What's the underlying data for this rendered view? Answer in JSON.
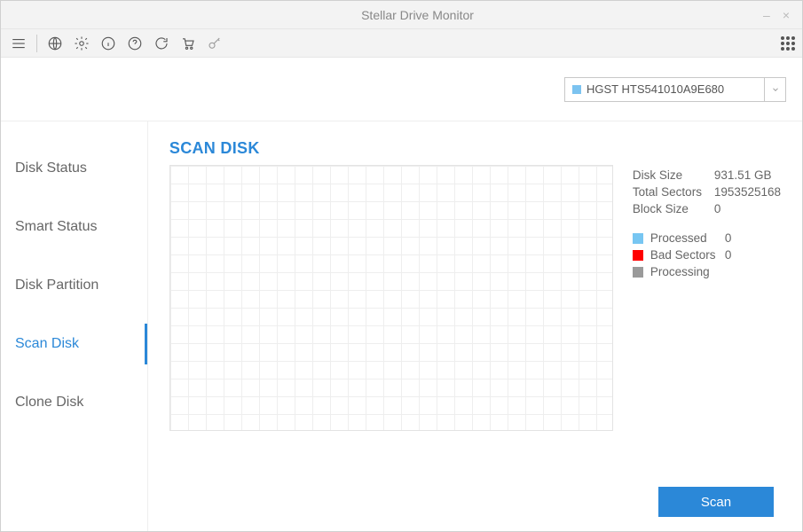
{
  "window": {
    "title": "Stellar Drive Monitor"
  },
  "drive": {
    "selected": "HGST HTS541010A9E680"
  },
  "sidebar": {
    "items": [
      {
        "label": "Disk Status"
      },
      {
        "label": "Smart Status"
      },
      {
        "label": "Disk Partition"
      },
      {
        "label": "Scan Disk"
      },
      {
        "label": "Clone Disk"
      }
    ],
    "activeIndex": 3
  },
  "section": {
    "title": "SCAN DISK"
  },
  "stats": {
    "diskSizeLabel": "Disk Size",
    "diskSize": "931.51 GB",
    "totalSectorsLabel": "Total Sectors",
    "totalSectors": "1953525168",
    "blockSizeLabel": "Block Size",
    "blockSize": "0",
    "processedLabel": "Processed",
    "processed": "0",
    "badSectorsLabel": "Bad Sectors",
    "badSectors": "0",
    "processingLabel": "Processing"
  },
  "actions": {
    "scan": "Scan"
  }
}
